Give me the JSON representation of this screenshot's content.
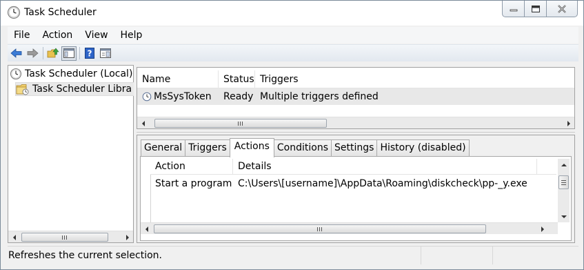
{
  "window": {
    "title": "Task Scheduler",
    "icon": "clock-icon"
  },
  "menu": [
    "File",
    "Action",
    "View",
    "Help"
  ],
  "toolbar": {
    "buttons": [
      "back-arrow-icon",
      "forward-arrow-icon",
      "up-folder-icon",
      "show-hide-console-tree-icon",
      "help-icon",
      "show-hide-action-pane-icon"
    ]
  },
  "tree": {
    "root_label": "Task Scheduler (Local)",
    "child_label": "Task Scheduler Libra"
  },
  "tasks": {
    "columns": [
      "Name",
      "Status",
      "Triggers"
    ],
    "rows": [
      {
        "name": "MsSysToken",
        "status": "Ready",
        "triggers": "Multiple triggers defined"
      }
    ]
  },
  "tabs": [
    {
      "label": "General",
      "selected": false
    },
    {
      "label": "Triggers",
      "selected": false
    },
    {
      "label": "Actions",
      "selected": true
    },
    {
      "label": "Conditions",
      "selected": false
    },
    {
      "label": "Settings",
      "selected": false
    },
    {
      "label": "History (disabled)",
      "selected": false
    }
  ],
  "actions": {
    "columns": [
      "Action",
      "Details"
    ],
    "rows": [
      {
        "action": "Start a program",
        "details": "C:\\Users\\[username]\\AppData\\Roaming\\diskcheck\\pp-_y.exe"
      }
    ]
  },
  "status": {
    "text": "Refreshes the current selection."
  },
  "colors": {
    "accent_blue": "#2a6fc9",
    "selection_gray": "#e8e8e8",
    "border": "#a0a0a0"
  }
}
